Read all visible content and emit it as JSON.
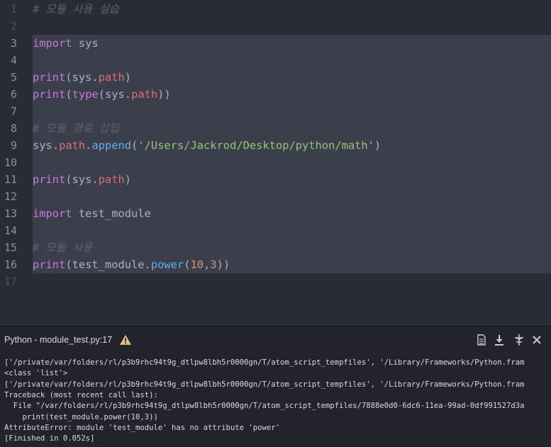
{
  "editor": {
    "line_numbers": [
      "1",
      "2",
      "3",
      "4",
      "5",
      "6",
      "7",
      "8",
      "9",
      "10",
      "11",
      "12",
      "13",
      "14",
      "15",
      "16",
      "17"
    ],
    "lines": [
      {
        "tokens": [
          {
            "t": "cmt",
            "v": "# 모듈 사용 실습"
          }
        ]
      },
      {
        "tokens": []
      },
      {
        "tokens": [
          {
            "t": "kw",
            "v": "import"
          },
          {
            "t": "id",
            "v": " sys"
          }
        ]
      },
      {
        "tokens": []
      },
      {
        "tokens": [
          {
            "t": "kw",
            "v": "print"
          },
          {
            "t": "pun",
            "v": "("
          },
          {
            "t": "id",
            "v": "sys"
          },
          {
            "t": "pun",
            "v": "."
          },
          {
            "t": "attr",
            "v": "path"
          },
          {
            "t": "pun",
            "v": ")"
          }
        ]
      },
      {
        "tokens": [
          {
            "t": "kw",
            "v": "print"
          },
          {
            "t": "pun",
            "v": "("
          },
          {
            "t": "kw",
            "v": "type"
          },
          {
            "t": "pun",
            "v": "("
          },
          {
            "t": "id",
            "v": "sys"
          },
          {
            "t": "pun",
            "v": "."
          },
          {
            "t": "attr",
            "v": "path"
          },
          {
            "t": "pun",
            "v": "))"
          }
        ]
      },
      {
        "tokens": []
      },
      {
        "tokens": [
          {
            "t": "cmt",
            "v": "# 모듈 경로 삽입"
          }
        ]
      },
      {
        "tokens": [
          {
            "t": "id",
            "v": "sys"
          },
          {
            "t": "pun",
            "v": "."
          },
          {
            "t": "attr",
            "v": "path"
          },
          {
            "t": "pun",
            "v": "."
          },
          {
            "t": "fn",
            "v": "append"
          },
          {
            "t": "pun",
            "v": "("
          },
          {
            "t": "str",
            "v": "'/Users/Jackrod/Desktop/python/math'"
          },
          {
            "t": "pun",
            "v": ")"
          }
        ]
      },
      {
        "tokens": []
      },
      {
        "tokens": [
          {
            "t": "kw",
            "v": "print"
          },
          {
            "t": "pun",
            "v": "("
          },
          {
            "t": "id",
            "v": "sys"
          },
          {
            "t": "pun",
            "v": "."
          },
          {
            "t": "attr",
            "v": "path"
          },
          {
            "t": "pun",
            "v": ")"
          }
        ]
      },
      {
        "tokens": []
      },
      {
        "tokens": [
          {
            "t": "kw",
            "v": "import"
          },
          {
            "t": "id",
            "v": " test_module"
          }
        ]
      },
      {
        "tokens": []
      },
      {
        "tokens": [
          {
            "t": "cmt",
            "v": "# 모듈 사용"
          }
        ]
      },
      {
        "tokens": [
          {
            "t": "kw",
            "v": "print"
          },
          {
            "t": "pun",
            "v": "("
          },
          {
            "t": "id",
            "v": "test_module"
          },
          {
            "t": "pun",
            "v": "."
          },
          {
            "t": "fn",
            "v": "power"
          },
          {
            "t": "pun",
            "v": "("
          },
          {
            "t": "num",
            "v": "10"
          },
          {
            "t": "pun",
            "v": ","
          },
          {
            "t": "num",
            "v": "3"
          },
          {
            "t": "pun",
            "v": "))"
          }
        ]
      },
      {
        "tokens": []
      }
    ]
  },
  "panel": {
    "title": "Python - module_test.py:17",
    "icons": [
      "document-icon",
      "download-icon",
      "pin-icon",
      "close-icon"
    ],
    "output_lines": [
      "['/private/var/folders/rl/p3b9rhc94t9g_dtlpw8lbh5r0000gn/T/atom_script_tempfiles', '/Library/Frameworks/Python.fram",
      "<class 'list'>",
      "['/private/var/folders/rl/p3b9rhc94t9g_dtlpw8lbh5r0000gn/T/atom_script_tempfiles', '/Library/Frameworks/Python.fram",
      "Traceback (most recent call last):",
      "  File \"/var/folders/rl/p3b9rhc94t9g_dtlpw8lbh5r0000gn/T/atom_script_tempfiles/7888e0d0-6dc6-11ea-99ad-0df991527d3a",
      "    print(test_module.power(10,3))",
      "AttributeError: module 'test_module' has no attribute 'power'",
      "[Finished in 0.052s]"
    ]
  },
  "colors": {
    "keyword": "#c678dd",
    "function": "#61afef",
    "attribute": "#e06c75",
    "string": "#98c379",
    "number": "#d19a66",
    "comment": "#5c6370",
    "warning": "#e5c07b"
  }
}
